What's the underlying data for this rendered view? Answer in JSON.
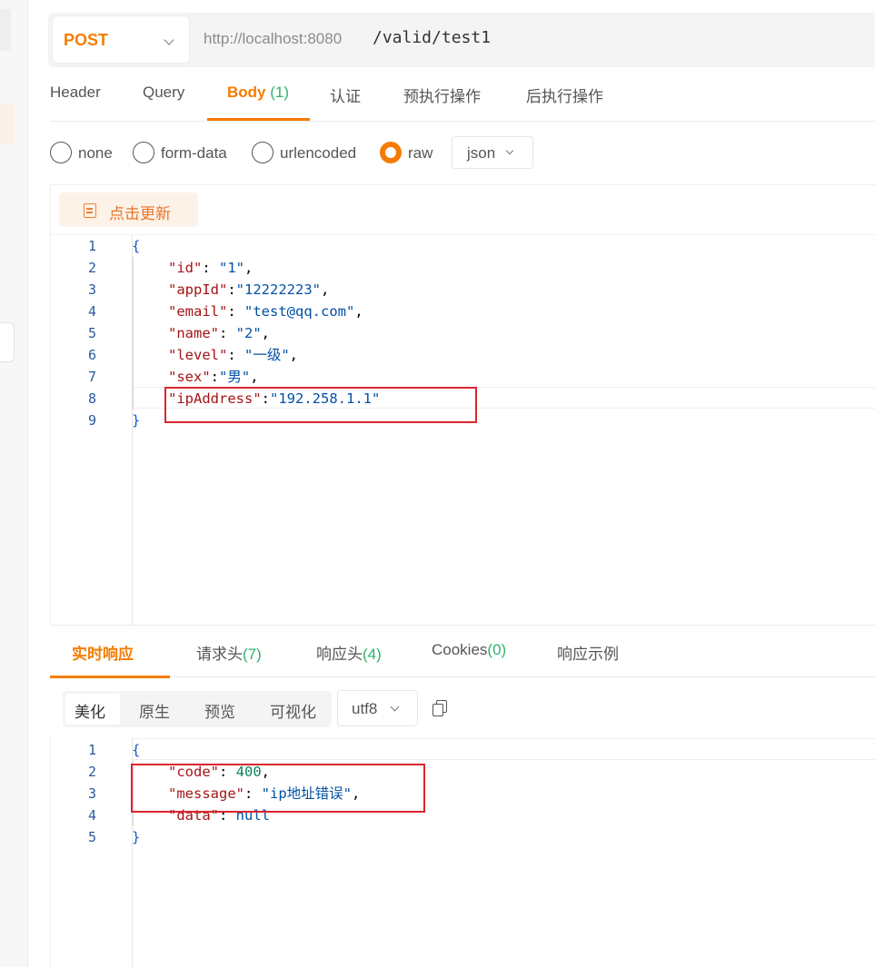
{
  "request": {
    "method": "POST",
    "url_host": "http://localhost:8080",
    "url_path": "/valid/test1"
  },
  "tabs": [
    {
      "label": "Header",
      "count": ""
    },
    {
      "label": "Query",
      "count": ""
    },
    {
      "label": "Body",
      "count": "(1)"
    },
    {
      "label": "认证",
      "count": ""
    },
    {
      "label": "预执行操作",
      "count": ""
    },
    {
      "label": "后执行操作",
      "count": ""
    }
  ],
  "active_tab": "Body",
  "body_types": {
    "options": [
      "none",
      "form-data",
      "urlencoded",
      "raw"
    ],
    "selected": "raw",
    "format": "json"
  },
  "update_button": "点击更新",
  "request_body": {
    "line_numbers": [
      "1",
      "2",
      "3",
      "4",
      "5",
      "6",
      "7",
      "8",
      "9"
    ],
    "open_brace": "{",
    "close_brace": "}",
    "fields": [
      {
        "key": "\"id\"",
        "sep": ": ",
        "value": "\"1\"",
        "tail": ","
      },
      {
        "key": "\"appId\"",
        "sep": ":",
        "value": "\"12222223\"",
        "tail": ","
      },
      {
        "key": "\"email\"",
        "sep": ": ",
        "value": "\"test@qq.com\"",
        "tail": ","
      },
      {
        "key": "\"name\"",
        "sep": ": ",
        "value": "\"2\"",
        "tail": ","
      },
      {
        "key": "\"level\"",
        "sep": ": ",
        "value": "\"一级\"",
        "tail": ","
      },
      {
        "key": "\"sex\"",
        "sep": ":",
        "value": "\"男\"",
        "tail": ","
      },
      {
        "key": "\"ipAddress\"",
        "sep": ":",
        "value": "\"192.258.1.1\"",
        "tail": ""
      }
    ]
  },
  "response_tabs": [
    {
      "label": "实时响应",
      "count": ""
    },
    {
      "label": "请求头",
      "count": "(7)"
    },
    {
      "label": "响应头",
      "count": "(4)"
    },
    {
      "label": "Cookies",
      "count": "(0)"
    },
    {
      "label": "响应示例",
      "count": ""
    }
  ],
  "view_modes": [
    "美化",
    "原生",
    "预览",
    "可视化"
  ],
  "active_view_mode": "美化",
  "encoding": "utf8",
  "response_body": {
    "line_numbers": [
      "1",
      "2",
      "3",
      "4",
      "5"
    ],
    "open_brace": "{",
    "close_brace": "}",
    "code_key": "\"code\"",
    "code_value": "400",
    "message_key": "\"message\"",
    "message_value": "\"ip地址错误\"",
    "data_key": "\"data\"",
    "data_value": "null"
  },
  "colors": {
    "accent": "#f57c00",
    "count_green": "#2db46c",
    "highlight_red": "#d9262e"
  }
}
